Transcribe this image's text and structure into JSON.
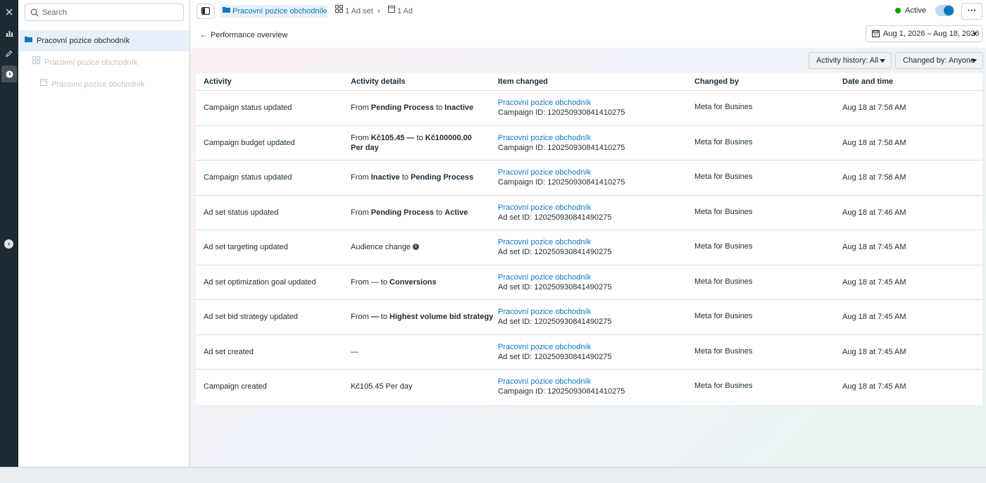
{
  "search": {
    "placeholder": "Search"
  },
  "tree": {
    "campaign": "Pracovní pozice obchodník",
    "adset": "Pracovní pozice obchodník",
    "ad": "Pracovní pozice obchodník"
  },
  "breadcrumb": {
    "campaign": "Pracovní pozice obchodník",
    "adset": "1 Ad set",
    "ad": "1 Ad"
  },
  "status": {
    "label": "Active",
    "color": "#00a400"
  },
  "back_label": "Performance overview",
  "date_range": "Aug 1, 2026 – Aug 18, 2026",
  "filters": {
    "activity_history": "Activity history: All",
    "changed_by": "Changed by: Anyone"
  },
  "table": {
    "headers": {
      "activity": "Activity",
      "details": "Activity details",
      "item": "Item changed",
      "changed_by": "Changed by",
      "date": "Date and time"
    },
    "rows": [
      {
        "activity": "Campaign status updated",
        "d1": "From ",
        "d2": "Pending Process",
        "d3": " to ",
        "d4": "Inactive",
        "item": "Pracovní pozice obchodník",
        "item_id": "Campaign ID: 120250930841410275",
        "changed_by": "Meta for Busines",
        "date": "Aug 18 at 7:58 AM"
      },
      {
        "activity": "Campaign budget updated",
        "d1": "From ",
        "d2": "Kč105.45 —",
        "d3": " to ",
        "d4": "Kč100000.00 Per day",
        "item": "Pracovní pozice obchodník",
        "item_id": "Campaign ID: 120250930841410275",
        "changed_by": "Meta for Busines",
        "date": "Aug 18 at 7:58 AM"
      },
      {
        "activity": "Campaign status updated",
        "d1": "From ",
        "d2": "Inactive",
        "d3": " to ",
        "d4": "Pending Process",
        "item": "Pracovní pozice obchodník",
        "item_id": "Campaign ID: 120250930841410275",
        "changed_by": "Meta for Busines",
        "date": "Aug 18 at 7:58 AM"
      },
      {
        "activity": "Ad set status updated",
        "d1": "From ",
        "d2": "Pending Process",
        "d3": " to ",
        "d4": "Active",
        "item": "Pracovní pozice obchodník",
        "item_id": "Ad set ID: 120250930841490275",
        "changed_by": "Meta for Busines",
        "date": "Aug 18 at 7:46 AM"
      },
      {
        "activity": "Ad set targeting updated",
        "d1": "Audience change",
        "d2": "",
        "d3": "",
        "d4": "",
        "item": "Pracovní pozice obchodník",
        "item_id": "Ad set ID: 120250930841490275",
        "changed_by": "Meta for Busines",
        "date": "Aug 18 at 7:45 AM"
      },
      {
        "activity": "Ad set optimization goal updated",
        "d1": "From ",
        "d2": "—",
        "d3": " to ",
        "d4": "Conversions",
        "item": "Pracovní pozice obchodník",
        "item_id": "Ad set ID: 120250930841490275",
        "changed_by": "Meta for Busines",
        "date": "Aug 18 at 7:45 AM"
      },
      {
        "activity": "Ad set bid strategy updated",
        "d1": "From ",
        "d2": "—",
        "d3": " to ",
        "d4": "Highest volume bid strategy",
        "item": "Pracovní pozice obchodník",
        "item_id": "Ad set ID: 120250930841490275",
        "changed_by": "Meta for Busines",
        "date": "Aug 18 at 7:45 AM"
      },
      {
        "activity": "Ad set created",
        "d1": "—",
        "d2": "",
        "d3": "",
        "d4": "",
        "item": "Pracovní pozice obchodník",
        "item_id": "Ad set ID: 120250930841490275",
        "changed_by": "Meta for Busines",
        "date": "Aug 18 at 7:45 AM"
      },
      {
        "activity": "Campaign created",
        "d1": "Kč105.45 Per day",
        "d2": "",
        "d3": "",
        "d4": "",
        "item": "Pracovní pozice obchodník",
        "item_id": "Campaign ID: 120250930841410275",
        "changed_by": "Meta for Busines",
        "date": "Aug 18 at 7:45 AM"
      }
    ]
  }
}
